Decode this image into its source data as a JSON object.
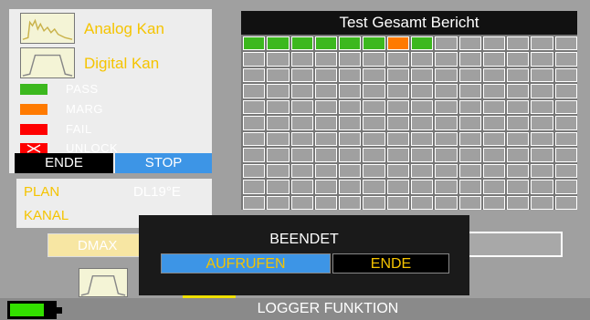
{
  "legend": {
    "analog_label": "Analog Kan",
    "digital_label": "Digital Kan",
    "pass_label": "PASS",
    "marg_label": "MARG",
    "fail_label": "FAIL",
    "unlock_label": "UNLOCK",
    "colors": {
      "pass": "#3cb81e",
      "marg": "#ff7a00",
      "fail": "#ff0000",
      "unlock": "#ff0000"
    }
  },
  "controls": {
    "ende_label": "ENDE",
    "stop_label": "STOP"
  },
  "plan": {
    "plan_label": "PLAN",
    "plan_value": "DL19°E",
    "kanal_label": "KANAL"
  },
  "report": {
    "title": "Test Gesamt Bericht",
    "columns": 14,
    "rows": 11,
    "row1_status": [
      "pass",
      "pass",
      "pass",
      "pass",
      "pass",
      "pass",
      "marg",
      "pass",
      "",
      "",
      "",
      "",
      "",
      ""
    ]
  },
  "dmax_label": "DMAX",
  "modal": {
    "title": "BEENDET",
    "recall_label": "AUFRUFEN",
    "end_label": "ENDE"
  },
  "status_bar": {
    "title": "LOGGER FUNKTION",
    "battery_level": 0.8
  }
}
